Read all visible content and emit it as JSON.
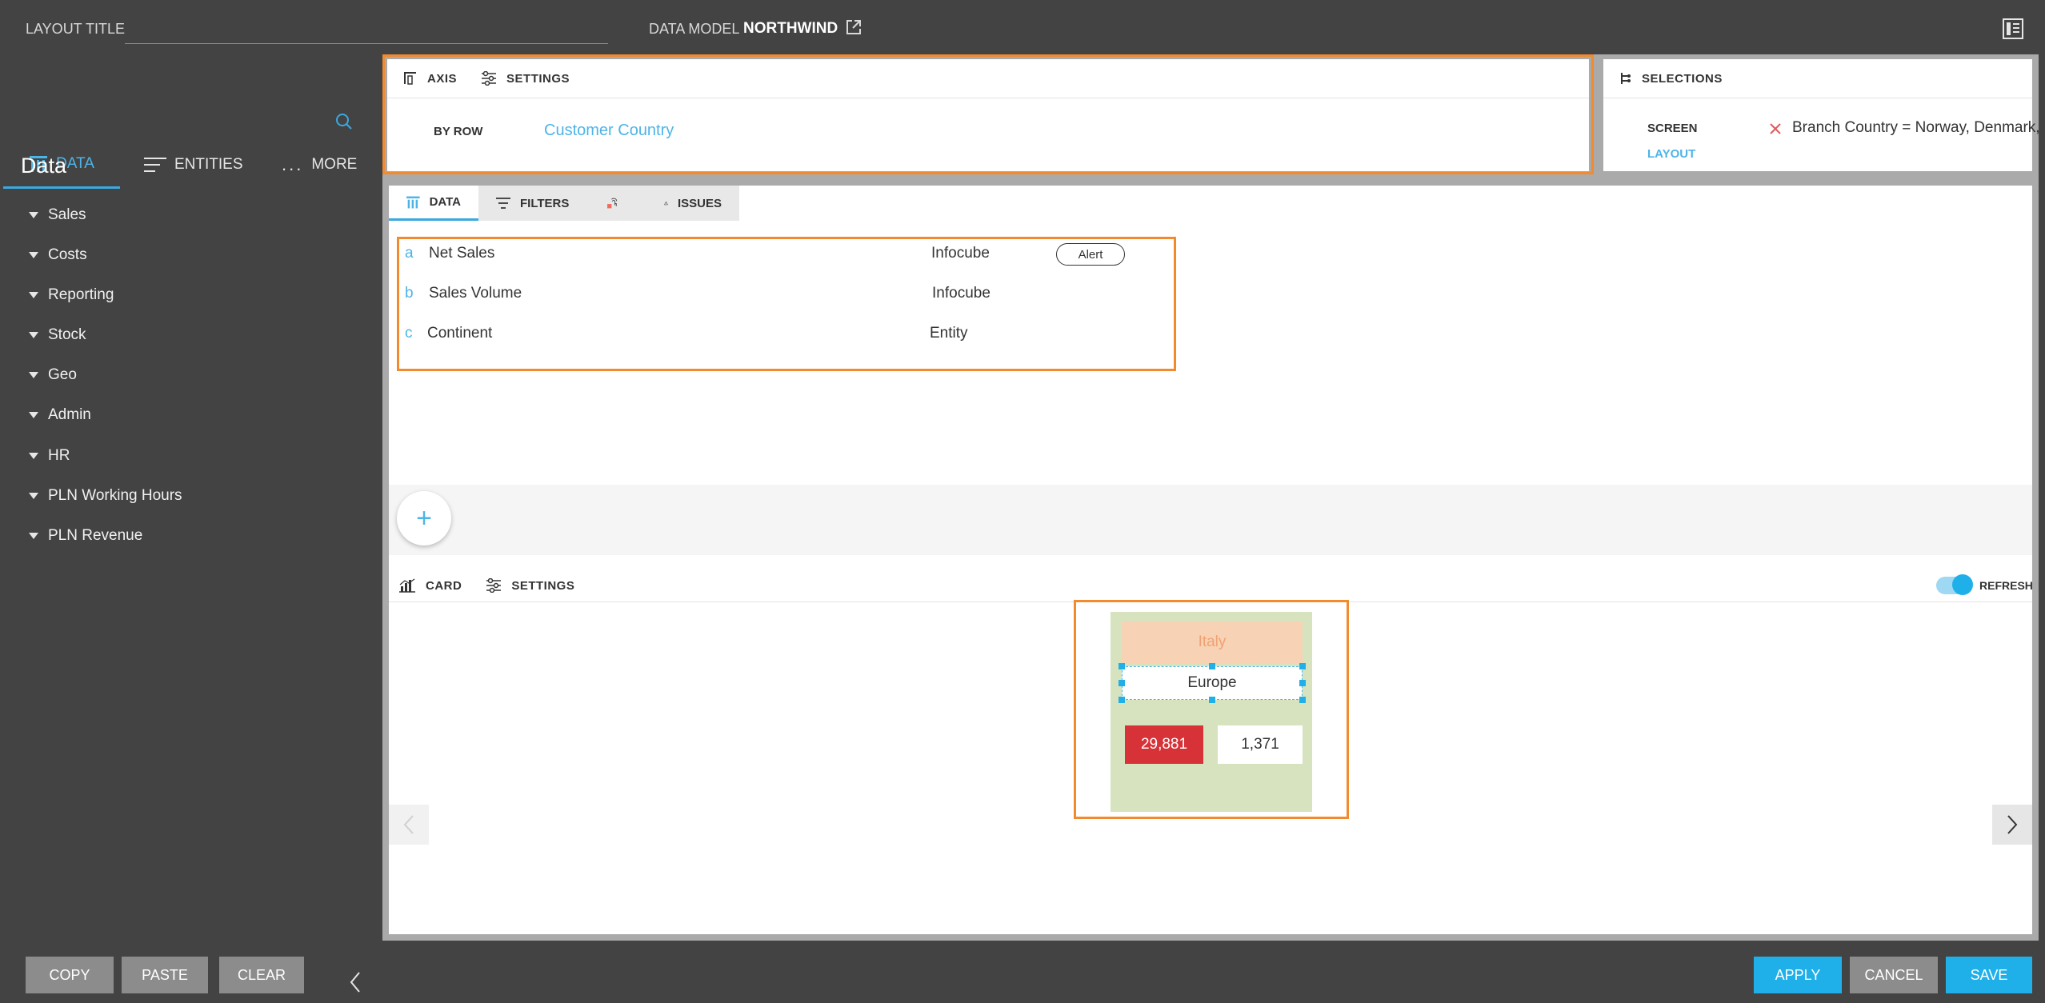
{
  "topbar": {
    "layout_title_label": "LAYOUT TITLE",
    "layout_title_value": "",
    "data_model_label": "DATA MODEL",
    "data_model_name": "NORTHWIND"
  },
  "sidebar": {
    "tabs": [
      {
        "label": "DATA",
        "icon": "data-grid-icon",
        "active": true
      },
      {
        "label": "ENTITIES",
        "icon": "entities-list-icon",
        "active": false
      },
      {
        "label": "MORE",
        "icon": "more-dots-icon",
        "active": false
      }
    ],
    "more_glyph": "...",
    "heading": "Data",
    "items": [
      "Sales",
      "Costs",
      "Reporting",
      "Stock",
      "Geo",
      "Admin",
      "HR",
      "PLN Working Hours",
      "PLN Revenue"
    ]
  },
  "axis_panel": {
    "tabs": [
      {
        "label": "AXIS"
      },
      {
        "label": "SETTINGS"
      }
    ],
    "by_row_label": "BY ROW",
    "by_row_value": "Customer Country"
  },
  "selections_panel": {
    "title": "SELECTIONS",
    "screen_label": "SCREEN",
    "layout_label": "LAYOUT",
    "selection_text": "Branch Country = Norway, Denmark, Poland"
  },
  "data_panel": {
    "tabs": [
      {
        "label": "DATA"
      },
      {
        "label": "FILTERS"
      },
      {
        "label": ""
      },
      {
        "label": "ISSUES"
      }
    ],
    "rows": [
      {
        "letter": "a",
        "name": "Net Sales",
        "source": "Infocube",
        "badge": "Alert"
      },
      {
        "letter": "b",
        "name": "Sales Volume",
        "source": "Infocube",
        "badge": ""
      },
      {
        "letter": "c",
        "name": "Continent",
        "source": "Entity",
        "badge": ""
      }
    ],
    "add_glyph": "+"
  },
  "card_panel": {
    "tabs": [
      {
        "label": "CARD"
      },
      {
        "label": "SETTINGS"
      }
    ],
    "refresh_label": "REFRESH",
    "refresh_on": true,
    "card": {
      "title": "Italy",
      "subtitle": "Europe",
      "value_1": "29,881",
      "value_2": "1,371"
    }
  },
  "bottombar": {
    "copy": "COPY",
    "paste": "PASTE",
    "clear": "CLEAR",
    "apply": "APPLY",
    "cancel": "CANCEL",
    "save": "SAVE"
  },
  "colors": {
    "accent": "#1fb0ea",
    "highlight_border": "#f28a2e",
    "alert_red": "#d63238",
    "card_bg": "#d7e3bf",
    "card_title_bg": "#f8d2b4"
  }
}
